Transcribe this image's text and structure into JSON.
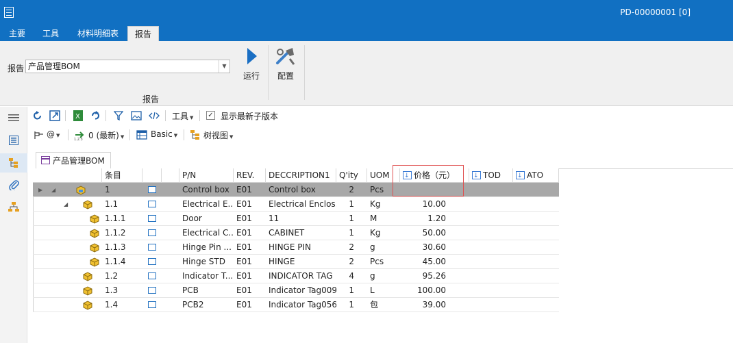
{
  "titlebar": {
    "doc_title": "PD-00000001 [0]"
  },
  "tabs": [
    {
      "label": "主要"
    },
    {
      "label": "工具"
    },
    {
      "label": "材料明细表"
    },
    {
      "label": "报告"
    }
  ],
  "ribbon": {
    "report_label": "报告",
    "report_value": "产品管理BOM",
    "run_label": "运行",
    "config_label": "配置",
    "group_label": "报告"
  },
  "toolbar1": {
    "tools_label": "工具",
    "show_latest_label": "显示最新子版本",
    "show_latest_checked": true
  },
  "toolbar2": {
    "at_label": "@",
    "version_label": "0 (最新)",
    "basic_label": "Basic",
    "treeview_label": "树视图"
  },
  "doc_tab": {
    "label": "产品管理BOM"
  },
  "grid": {
    "headers": {
      "item": "条目",
      "pn": "P/N",
      "rev": "REV.",
      "desc": "DECCRIPTION1",
      "qty": "Q'ity",
      "uom": "UOM",
      "price": "价格（元）",
      "tod": "TOD",
      "ato": "ATO"
    },
    "rows": [
      {
        "item": "1",
        "pn": "Control box",
        "rev": "E01",
        "desc": "Control box",
        "qty": "2",
        "uom": "Pcs",
        "price": ""
      },
      {
        "item": "1.1",
        "pn": "Electrical E...",
        "rev": "E01",
        "desc": "Electrical Enclos...",
        "qty": "1",
        "uom": "Kg",
        "price": "10.00"
      },
      {
        "item": "1.1.1",
        "pn": "Door",
        "rev": "E01",
        "desc": "11",
        "qty": "1",
        "uom": "M",
        "price": "1.20"
      },
      {
        "item": "1.1.2",
        "pn": "Electrical C...",
        "rev": "E01",
        "desc": "CABINET",
        "qty": "1",
        "uom": "Kg",
        "price": "50.00"
      },
      {
        "item": "1.1.3",
        "pn": "Hinge Pin ...",
        "rev": "E01",
        "desc": "HINGE PIN",
        "qty": "2",
        "uom": "g",
        "price": "30.60"
      },
      {
        "item": "1.1.4",
        "pn": "Hinge STD",
        "rev": "E01",
        "desc": "HINGE",
        "qty": "2",
        "uom": "Pcs",
        "price": "45.00"
      },
      {
        "item": "1.2",
        "pn": "Indicator T...",
        "rev": "E01",
        "desc": "INDICATOR TAG",
        "qty": "4",
        "uom": "g",
        "price": "95.26"
      },
      {
        "item": "1.3",
        "pn": "PCB",
        "rev": "E01",
        "desc": "Indicator Tag009",
        "qty": "1",
        "uom": "L",
        "price": "100.00"
      },
      {
        "item": "1.4",
        "pn": "PCB2",
        "rev": "E01",
        "desc": "Indicator Tag056",
        "qty": "1",
        "uom": "包",
        "price": "39.00"
      }
    ]
  },
  "colors": {
    "accent": "#1170c2",
    "selected_row": "#a8a8a8",
    "highlight": "#e05050"
  }
}
